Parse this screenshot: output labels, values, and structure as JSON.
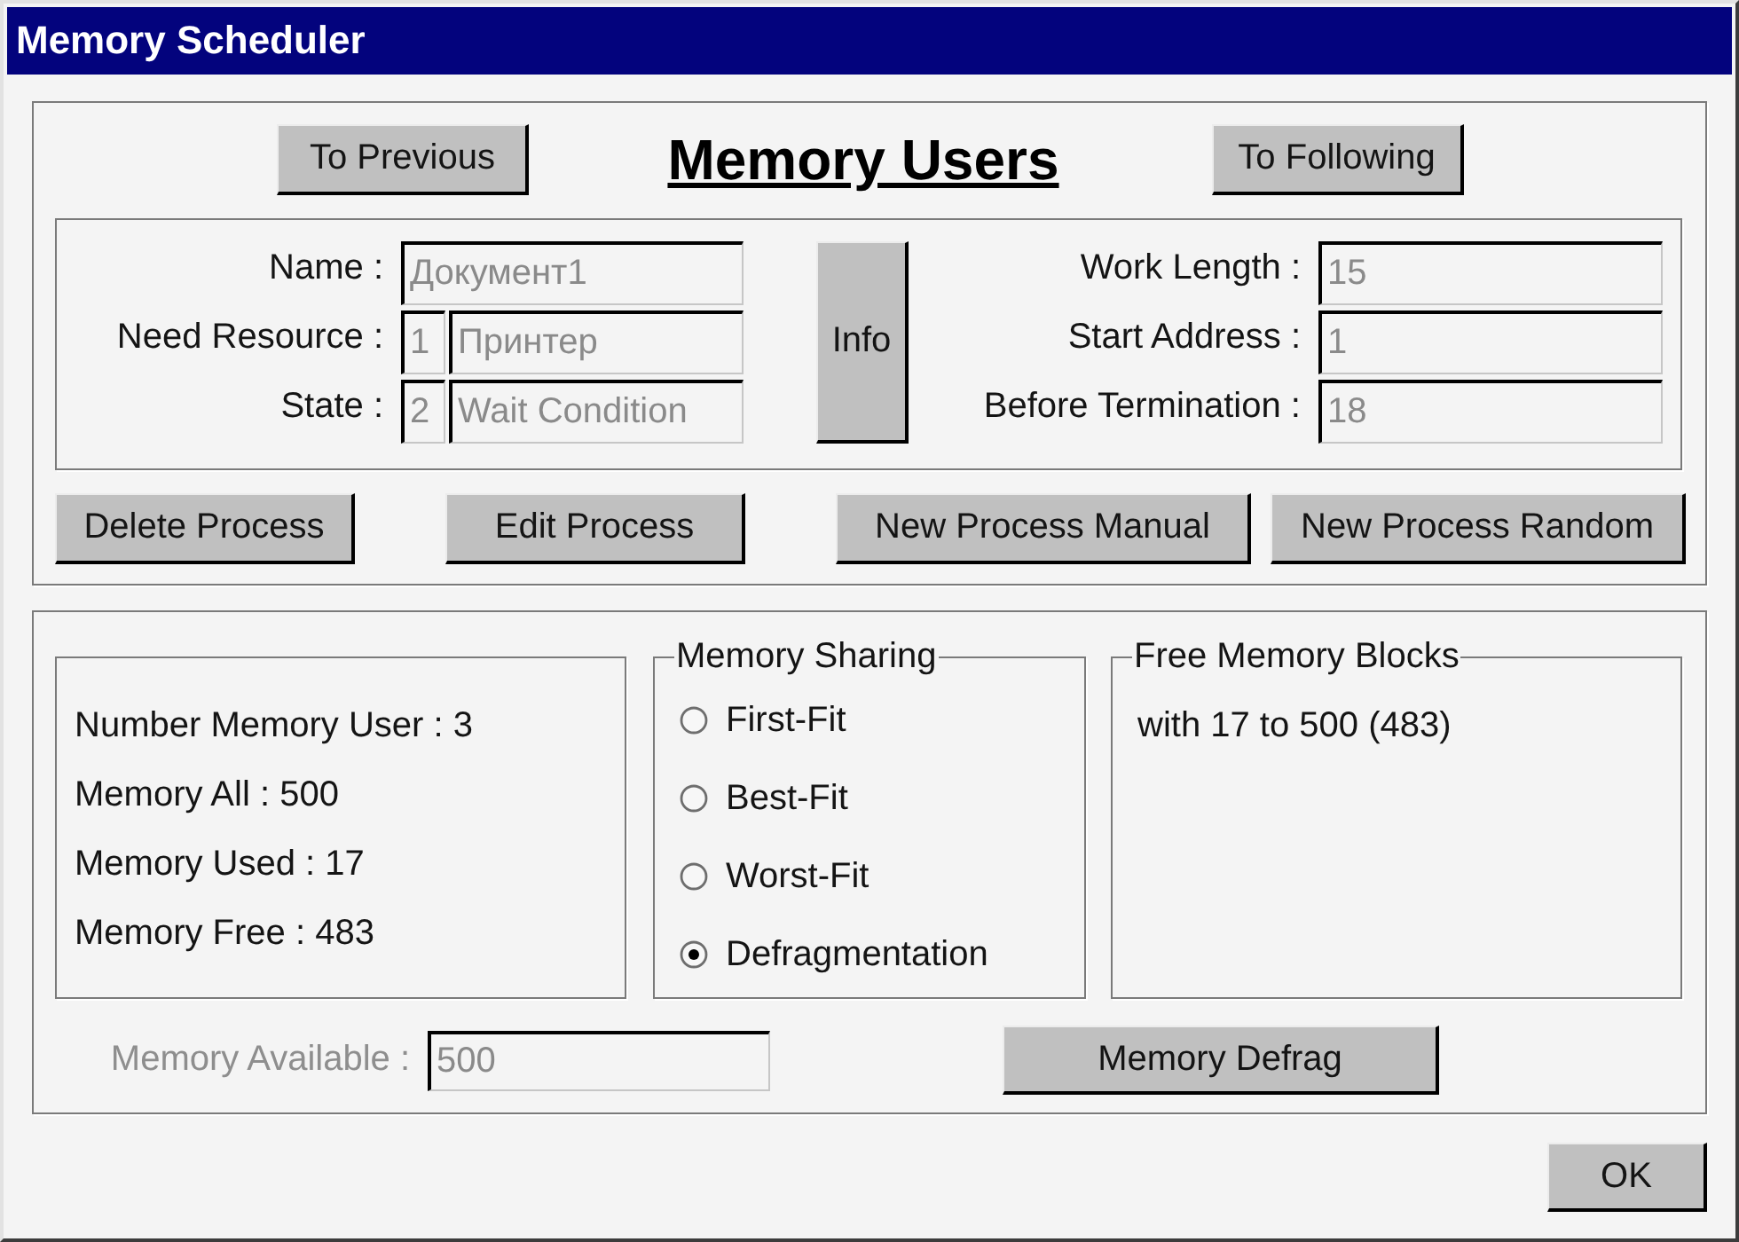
{
  "window": {
    "title": "Memory Scheduler"
  },
  "navigation": {
    "previous_button": "To Previous",
    "heading": "Memory Users",
    "next_button": "To Following"
  },
  "process_details": {
    "left_fields": [
      {
        "label": "Name :",
        "values": [
          "Документ1"
        ]
      },
      {
        "label": "Need Resource :",
        "values": [
          "1",
          "Принтер"
        ]
      },
      {
        "label": "State :",
        "values": [
          "2",
          "Wait Condition"
        ]
      }
    ],
    "info_button": "Info",
    "right_fields": [
      {
        "label": "Work Length :",
        "values": [
          "15"
        ]
      },
      {
        "label": "Start Address :",
        "values": [
          "1"
        ]
      },
      {
        "label": "Before Termination :",
        "values": [
          "18"
        ]
      }
    ]
  },
  "process_buttons": [
    "Delete Process",
    "Edit Process",
    "New Process Manual",
    "New Process Random"
  ],
  "statistics": [
    "Number Memory User : 3",
    "Memory All : 500",
    "Memory Used : 17",
    "Memory Free : 483"
  ],
  "memory_sharing": {
    "title": "Memory Sharing",
    "options": [
      {
        "label": "First-Fit",
        "selected": false
      },
      {
        "label": "Best-Fit",
        "selected": false
      },
      {
        "label": "Worst-Fit",
        "selected": false
      },
      {
        "label": "Defragmentation",
        "selected": true
      }
    ]
  },
  "free_memory_blocks": {
    "title": "Free Memory Blocks",
    "items": [
      "with 17 to 500 (483)"
    ]
  },
  "memory_available": {
    "label": "Memory Available :",
    "value": "500",
    "disabled": true
  },
  "defrag_button": "Memory Defrag",
  "ok_button": "OK"
}
